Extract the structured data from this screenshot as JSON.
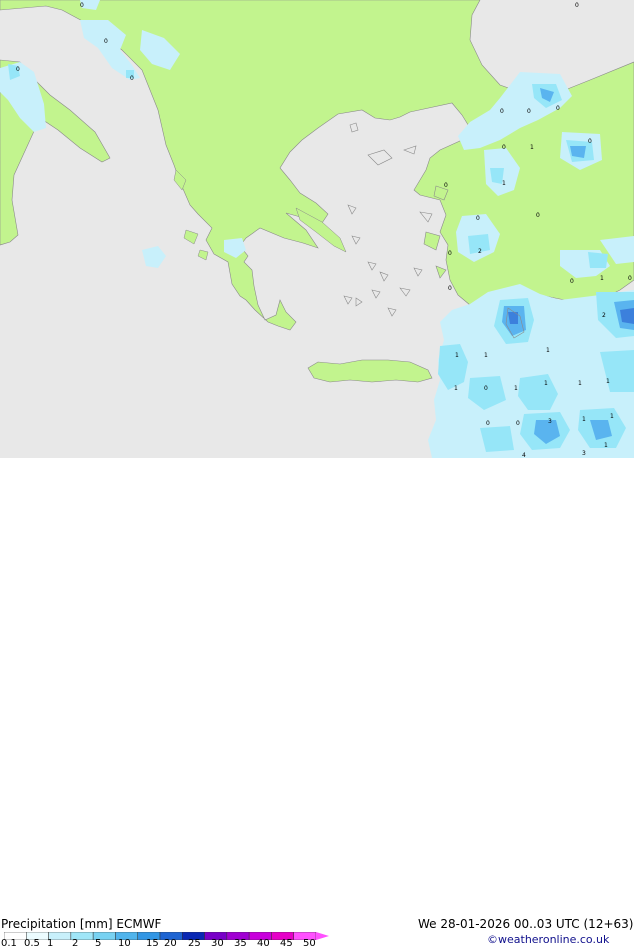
{
  "map": {
    "colors": {
      "sea": "#e8e8e8",
      "land": "#c2f48e",
      "precip_light": "#c8f0fb",
      "precip_medium": "#96e6f8",
      "precip_heavy": "#5ab4ef",
      "precip_max": "#3c80dc",
      "border": "#8a8a8a"
    },
    "point_labels": [
      "0",
      "0",
      "0",
      "0",
      "0",
      "0",
      "0",
      "0",
      "0",
      "0",
      "1",
      "0",
      "0",
      "0",
      "2",
      "0",
      "0",
      "1",
      "1",
      "0",
      "2",
      "0",
      "1",
      "1",
      "1",
      "0",
      "1",
      "1",
      "1",
      "1",
      "0",
      "3",
      "1",
      "1",
      "0",
      "1",
      "4",
      "3",
      "1"
    ]
  },
  "legend": {
    "title": "Precipitation [mm]  ECMWF",
    "ticks": [
      "0.1",
      "0.5",
      "1",
      "2",
      "5",
      "10",
      "15",
      "20",
      "25",
      "30",
      "35",
      "40",
      "45",
      "50"
    ],
    "colors": [
      "#ffffff",
      "#ecfcff",
      "#c8f0fb",
      "#a0e6f8",
      "#78d2f2",
      "#50b4ec",
      "#3296e4",
      "#1e64d2",
      "#0a28b4",
      "#7800c8",
      "#a000d2",
      "#c800dc",
      "#e600c8",
      "#ff50ff"
    ]
  },
  "run_info": "We 28-01-2026 00..03 UTC (12+63)",
  "credit": "©weatheronline.co.uk"
}
